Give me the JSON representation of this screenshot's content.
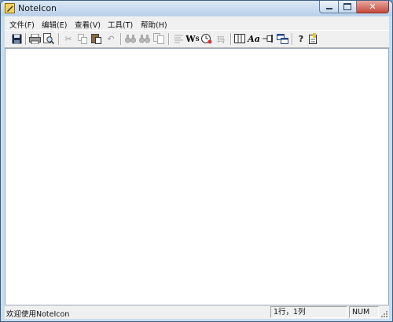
{
  "window": {
    "title": "NoteIcon"
  },
  "menu": [
    "文件(F)",
    "编辑(E)",
    "查看(V)",
    "工具(T)",
    "帮助(H)"
  ],
  "toolbar": [
    "save-icon",
    "print-icon",
    "print-preview-icon",
    "cut-icon",
    "copy-icon",
    "paste-icon",
    "undo-icon",
    "find-icon",
    "find-next-icon",
    "replace-icon",
    "align-left-icon",
    "word-wrap-icon",
    "clock-icon",
    "encoding-icon",
    "column-icon",
    "font-icon",
    "pin-icon",
    "window-icon",
    "help-icon",
    "about-icon"
  ],
  "status": {
    "message": "欢迎使用NoteIcon",
    "position": "1行，1列",
    "num": "NUM"
  }
}
